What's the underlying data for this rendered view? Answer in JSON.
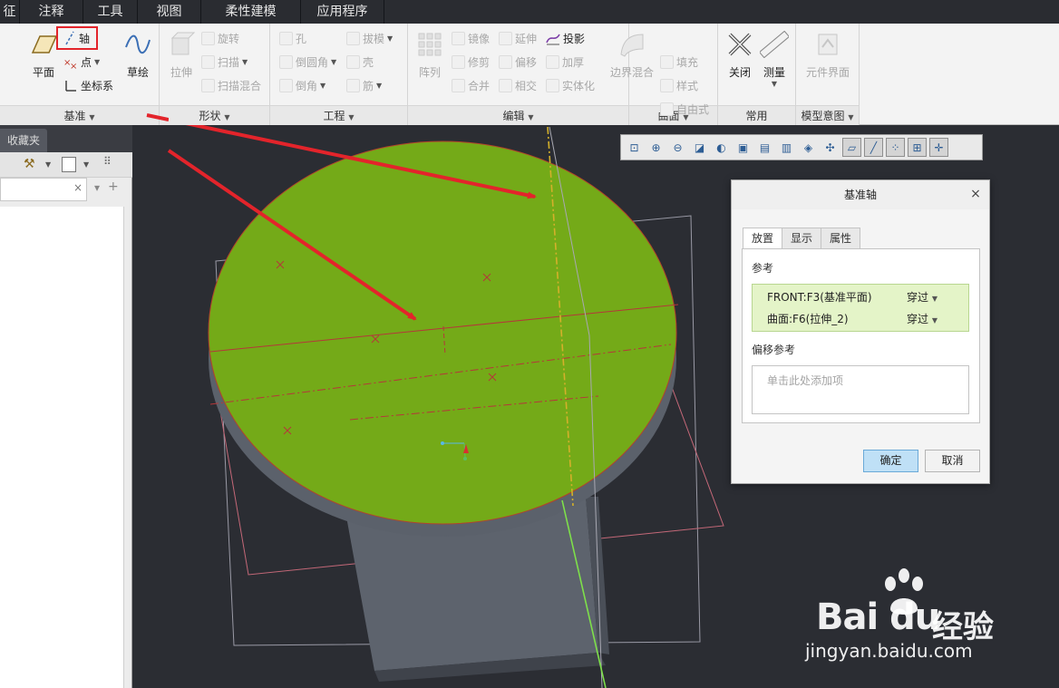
{
  "menu": {
    "tabs": [
      "征",
      "注释",
      "工具",
      "视图",
      "柔性建模",
      "应用程序"
    ]
  },
  "ribbon": {
    "groups": [
      {
        "label": "基准",
        "tools": {
          "plane": "平面",
          "axis": "轴",
          "point": "点",
          "csys": "坐标系",
          "sketch": "草绘"
        }
      },
      {
        "label": "形状",
        "tools": {
          "extrude": "拉伸",
          "revolve": "旋转",
          "sweep": "扫描",
          "swept_blend": "扫描混合"
        }
      },
      {
        "label": "工程",
        "tools": {
          "hole": "孔",
          "round": "倒圆角",
          "chamfer": "倒角",
          "draft": "拔模",
          "shell": "壳",
          "rib": "筋"
        }
      },
      {
        "label": "编辑",
        "tools": {
          "pattern": "阵列",
          "mirror": "镜像",
          "trim": "修剪",
          "merge": "合并",
          "extend": "延伸",
          "offset": "偏移",
          "intersect": "相交",
          "project": "投影",
          "thicken": "加厚",
          "solidify": "实体化"
        }
      },
      {
        "label": "曲面",
        "tools": {
          "boundary_blend": "边界混合",
          "fill": "填充",
          "style": "样式",
          "freestyle": "自由式"
        }
      },
      {
        "label": "常用",
        "tools": {
          "close": "关闭",
          "measure": "测量"
        }
      },
      {
        "label": "模型意图",
        "tools": {
          "component_interface": "元件界面"
        }
      }
    ]
  },
  "left_panel": {
    "tab": "收藏夹"
  },
  "view_toolbar": {
    "icons": [
      "refit-icon",
      "zoom-in-icon",
      "zoom-out-icon",
      "repaint-icon",
      "display-style-icon",
      "saved-views-icon",
      "named-views-icon",
      "perspective-icon",
      "view-manager-icon",
      "annotation-display-icon",
      "datum-display-icon",
      "plane-display-icon",
      "axis-display-icon",
      "point-display-icon",
      "csys-display-icon",
      "spin-center-icon"
    ]
  },
  "dialog": {
    "title": "基准轴",
    "tabs": [
      "放置",
      "显示",
      "属性"
    ],
    "references_label": "参考",
    "references": [
      {
        "name": "FRONT:F3(基准平面)",
        "type": "穿过"
      },
      {
        "name": "曲面:F6(拉伸_2)",
        "type": "穿过"
      }
    ],
    "offset_label": "偏移参考",
    "offset_placeholder": "单击此处添加项",
    "ok": "确定",
    "cancel": "取消",
    "close": "×"
  },
  "watermark": {
    "brand": "Bai du",
    "brand_cn": "经验",
    "url": "jingyan.baidu.com"
  },
  "colors": {
    "top_face": "#74aa18",
    "body_side": "#5d636d",
    "annotation_arrow": "#e3242b",
    "highlight_box": "#e3242b",
    "axis_line": "#7ee04a"
  }
}
